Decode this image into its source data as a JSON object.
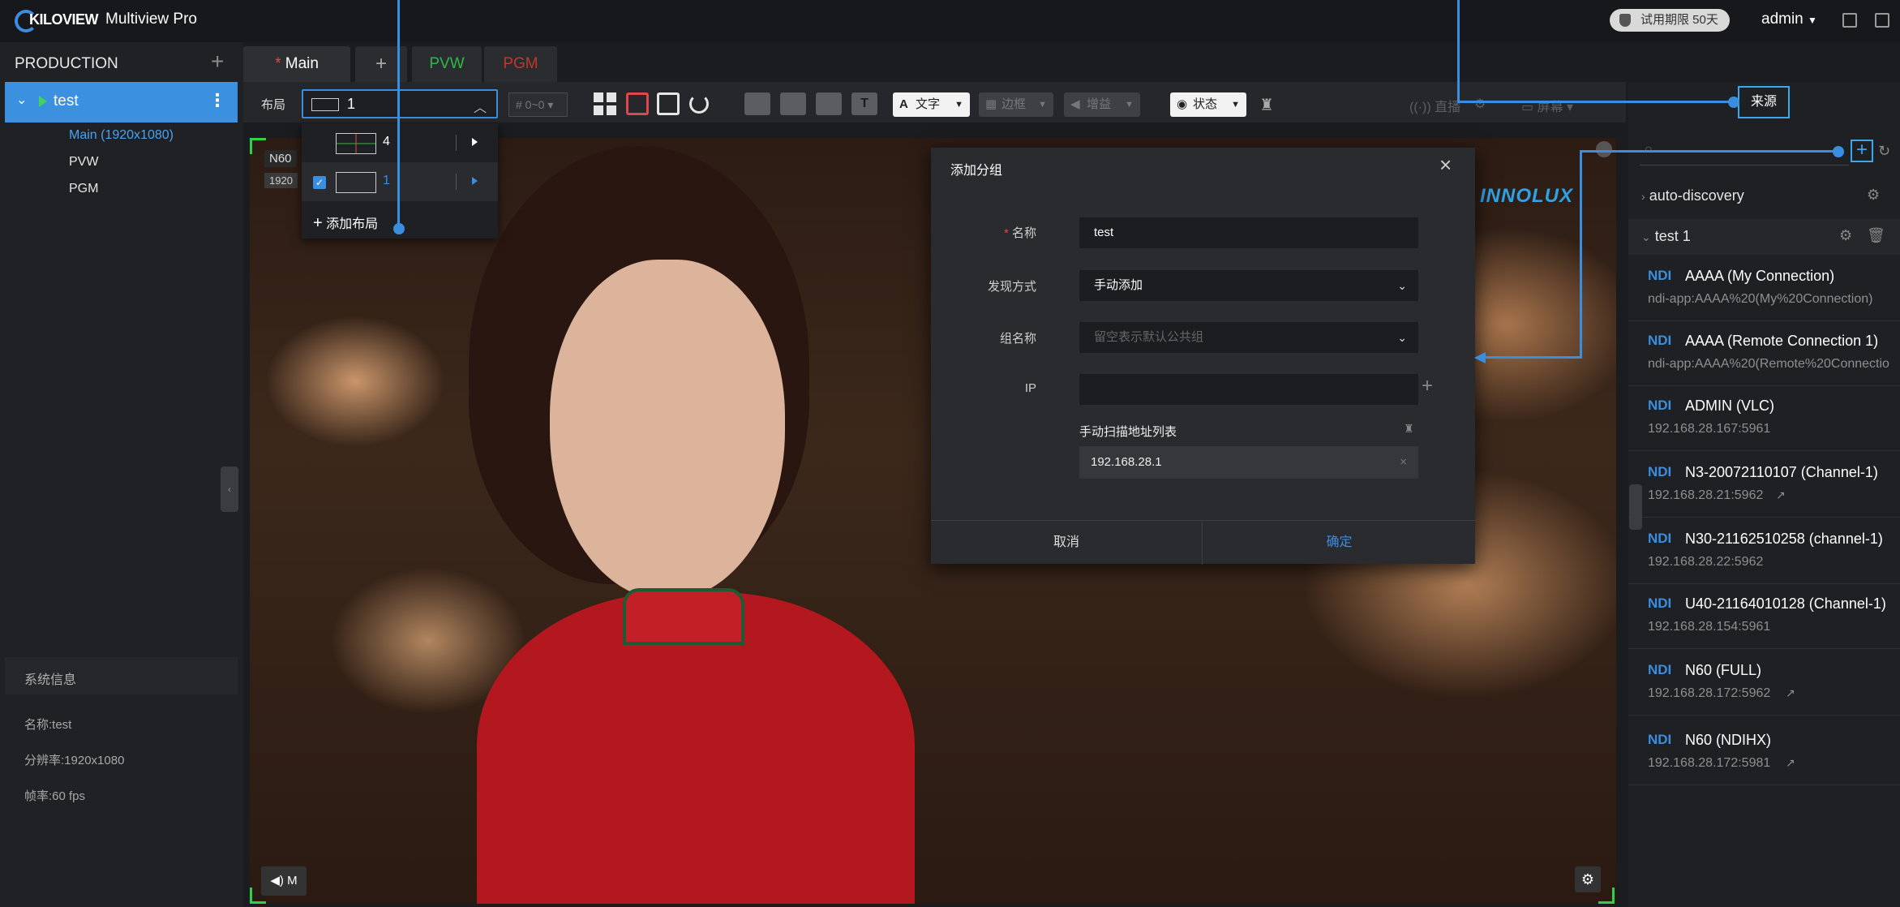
{
  "app": {
    "logo": "KILOVIEW",
    "title": "Multiview Pro",
    "trial_badge": "试用期限 50天",
    "user": "admin"
  },
  "sidebar": {
    "header": "PRODUCTION",
    "selected_item": "test",
    "tree": [
      "Main (1920x1080)",
      "PVW",
      "PGM"
    ]
  },
  "system_info": {
    "title": "系统信息",
    "name": "名称:test",
    "resolution": "分辨率:1920x1080",
    "framerate": "帧率:60 fps"
  },
  "tabs": [
    {
      "label": "Main",
      "modified_marker": "*"
    },
    {
      "label": "+"
    },
    {
      "label": "PVW",
      "color": "#2fb84a"
    },
    {
      "label": "PGM",
      "color": "#c0392b"
    }
  ],
  "toolbar": {
    "layout_label": "布局",
    "layout_value": "1",
    "dimension_value": "# 0~0",
    "text_label": "文字",
    "border_label": "边框",
    "gain_label": "增益",
    "status_label": "状态",
    "live_label": "直播",
    "screen_label": "屏幕"
  },
  "layout_dropdown": {
    "items": [
      {
        "label": "4",
        "checked": false
      },
      {
        "label": "1",
        "checked": true
      }
    ],
    "add_label": "添加布局"
  },
  "video": {
    "badge": "N60",
    "badge_sub": "1920",
    "watermark": "INNOLUX",
    "audio_label": "M"
  },
  "modal": {
    "title": "添加分组",
    "name_label": "名称",
    "name_value": "test",
    "discovery_label": "发现方式",
    "discovery_value": "手动添加",
    "group_label": "组名称",
    "group_placeholder": "留空表示默认公共组",
    "ip_label": "IP",
    "scan_list_label": "手动扫描地址列表",
    "scan_list_items": [
      "192.168.28.1"
    ],
    "cancel": "取消",
    "confirm": "确定"
  },
  "sources_panel": {
    "tab_label": "来源",
    "groups": [
      {
        "name": "auto-discovery",
        "expanded": false
      },
      {
        "name": "test 1",
        "expanded": true
      }
    ],
    "sources": [
      {
        "type": "NDI",
        "name": "AAAA (My Connection)",
        "address": "ndi-app:AAAA%20(My%20Connection)"
      },
      {
        "type": "NDI",
        "name": "AAAA (Remote Connection 1)",
        "address": "ndi-app:AAAA%20(Remote%20Connectio"
      },
      {
        "type": "NDI",
        "name": "ADMIN (VLC)",
        "address": "192.168.28.167:5961"
      },
      {
        "type": "NDI",
        "name": "N3-20072110107 (Channel-1)",
        "address": "192.168.28.21:5962"
      },
      {
        "type": "NDI",
        "name": "N30-21162510258 (channel-1)",
        "address": "192.168.28.22:5962"
      },
      {
        "type": "NDI",
        "name": "U40-21164010128 (Channel-1)",
        "address": "192.168.28.154:5961"
      },
      {
        "type": "NDI",
        "name": "N60 (FULL)",
        "address": "192.168.28.172:5962"
      },
      {
        "type": "NDI",
        "name": "N60 (NDIHX)",
        "address": "192.168.28.172:5981"
      }
    ]
  },
  "colors": {
    "accent": "#3b8de0",
    "annotation": "#3a8ee0",
    "preview_border": "#2fd14b",
    "save_red": "#e0474c"
  }
}
